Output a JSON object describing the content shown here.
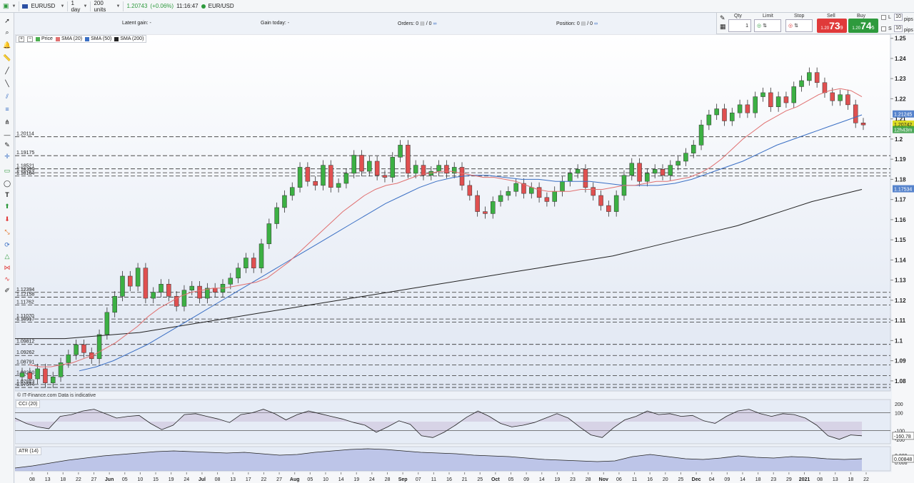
{
  "toolbar": {
    "symbol": "EURUSD",
    "timeframe": "1 day",
    "units": "200 units",
    "price": "1.20743",
    "change": "(+0.06%)",
    "time": "11:16:47",
    "instrument": "EUR/USD"
  },
  "info_bar": {
    "latent_gain": "Latent gain: -",
    "gain_today": "Gain today: -",
    "orders_label": "Orders:",
    "orders_value": "0",
    "orders_value2": "0",
    "position_label": "Position:",
    "position_value": "0",
    "position_value2": "0"
  },
  "trade_panel": {
    "qty_label": "Qty",
    "qty_value": "1",
    "limit_label": "Limit",
    "stop_label": "Stop",
    "sell_label": "Sell",
    "buy_label": "Buy",
    "sell_prefix": "1.20",
    "sell_big": "73",
    "sell_sup": "9",
    "buy_prefix": "1.20",
    "buy_big": "74",
    "buy_sup": "5",
    "l_label": "L",
    "s_label": "S",
    "l_value": "10",
    "s_value": "10",
    "pips_label": "pips",
    "sell_color": "#e03a3a",
    "buy_color": "#2e9a3d"
  },
  "legend": {
    "items": [
      {
        "label": "Price",
        "color": "#4caf50"
      },
      {
        "label": "SMA (20)",
        "color": "#e07070"
      },
      {
        "label": "SMA (50)",
        "color": "#3a6fc4"
      },
      {
        "label": "SMA (200)",
        "color": "#222222"
      }
    ]
  },
  "watermark": "© IT-Finance.com  Data is indicative",
  "cci_label": "CCI (20)",
  "atr_label": "ATR (14)",
  "chart_data": {
    "type": "candlestick",
    "instrument": "EURUSD",
    "y_ticks": [
      "1.25",
      "1.24",
      "1.23",
      "1.22",
      "1.21",
      "1.2",
      "1.19",
      "1.18",
      "1.17",
      "1.16",
      "1.15",
      "1.14",
      "1.13",
      "1.12",
      "1.11",
      "1.1",
      "1.09",
      "1.08"
    ],
    "ylim": [
      1.075,
      1.252
    ],
    "x_labels": [
      "08",
      "13",
      "18",
      "22",
      "27",
      "Jun",
      "05",
      "10",
      "15",
      "19",
      "24",
      "Jul",
      "08",
      "13",
      "17",
      "22",
      "27",
      "Aug",
      "05",
      "10",
      "14",
      "19",
      "24",
      "28",
      "Sep",
      "07",
      "11",
      "16",
      "21",
      "25",
      "Oct",
      "05",
      "09",
      "14",
      "19",
      "23",
      "28",
      "Nov",
      "06",
      "11",
      "16",
      "20",
      "25",
      "Dec",
      "04",
      "09",
      "14",
      "18",
      "23",
      "29",
      "2021",
      "08",
      "13",
      "18",
      "22"
    ],
    "right_markers": [
      {
        "label": "1.21245",
        "value": 1.21245,
        "color": "#3a6fc4"
      },
      {
        "label": "1.20742",
        "value": 1.20742,
        "color": "#d8d800"
      },
      {
        "label": "12h43m",
        "value": 1.2047,
        "color": "#2e9a3d"
      },
      {
        "label": "1.17534",
        "value": 1.17534,
        "color": "#3a6fc4"
      }
    ],
    "horizontal_levels": [
      {
        "label": "1.20114",
        "value": 1.20114
      },
      {
        "label": "1.19175",
        "value": 1.19175
      },
      {
        "label": "1.18521",
        "value": 1.18521
      },
      {
        "label": "1.18329",
        "value": 1.18329
      },
      {
        "label": "1.18164",
        "value": 1.18164
      },
      {
        "label": "1.12394",
        "value": 1.12394
      },
      {
        "label": "1.12158",
        "value": 1.12158
      },
      {
        "label": "1.11762",
        "value": 1.11762
      },
      {
        "label": "1.11070",
        "value": 1.1107
      },
      {
        "label": "1.10917",
        "value": 1.10917
      },
      {
        "label": "1.09812",
        "value": 1.09812
      },
      {
        "label": "1.09262",
        "value": 1.09262
      },
      {
        "label": "1.08791",
        "value": 1.08791
      },
      {
        "label": "1.08260",
        "value": 1.0826
      },
      {
        "label": "1.07823",
        "value": 1.07823
      },
      {
        "label": "1.07674",
        "value": 1.07674
      }
    ],
    "close_series": [
      1.084,
      1.081,
      1.086,
      1.079,
      1.082,
      1.089,
      1.093,
      1.098,
      1.094,
      1.091,
      1.103,
      1.114,
      1.122,
      1.132,
      1.127,
      1.136,
      1.121,
      1.124,
      1.128,
      1.122,
      1.117,
      1.125,
      1.127,
      1.121,
      1.126,
      1.124,
      1.128,
      1.131,
      1.136,
      1.141,
      1.136,
      1.148,
      1.158,
      1.166,
      1.172,
      1.176,
      1.186,
      1.179,
      1.177,
      1.187,
      1.176,
      1.178,
      1.183,
      1.192,
      1.184,
      1.189,
      1.182,
      1.181,
      1.191,
      1.197,
      1.183,
      1.187,
      1.182,
      1.184,
      1.187,
      1.183,
      1.186,
      1.177,
      1.172,
      1.164,
      1.163,
      1.169,
      1.172,
      1.174,
      1.178,
      1.173,
      1.176,
      1.171,
      1.169,
      1.174,
      1.179,
      1.183,
      1.185,
      1.176,
      1.172,
      1.167,
      1.164,
      1.172,
      1.182,
      1.188,
      1.179,
      1.183,
      1.185,
      1.182,
      1.187,
      1.189,
      1.193,
      1.197,
      1.207,
      1.212,
      1.215,
      1.209,
      1.213,
      1.217,
      1.213,
      1.221,
      1.223,
      1.216,
      1.221,
      1.218,
      1.226,
      1.229,
      1.233,
      1.228,
      1.223,
      1.219,
      1.222,
      1.217,
      1.208,
      1.207
    ],
    "sma20": [
      1.088,
      1.087,
      1.087,
      1.088,
      1.089,
      1.091,
      1.093,
      1.096,
      1.099,
      1.103,
      1.107,
      1.112,
      1.116,
      1.119,
      1.122,
      1.124,
      1.125,
      1.126,
      1.126,
      1.127,
      1.128,
      1.129,
      1.131,
      1.135,
      1.139,
      1.144,
      1.149,
      1.154,
      1.159,
      1.164,
      1.168,
      1.172,
      1.175,
      1.177,
      1.178,
      1.18,
      1.182,
      1.183,
      1.184,
      1.184,
      1.183,
      1.182,
      1.181,
      1.181,
      1.18,
      1.179,
      1.177,
      1.175,
      1.174,
      1.174,
      1.174,
      1.175,
      1.175,
      1.175,
      1.176,
      1.177,
      1.177,
      1.178,
      1.179,
      1.179,
      1.18,
      1.181,
      1.183,
      1.186,
      1.19,
      1.195,
      1.2,
      1.204,
      1.208,
      1.211,
      1.214,
      1.216,
      1.219,
      1.222,
      1.224,
      1.225,
      1.224,
      1.221
    ],
    "sma50": [
      1.085,
      1.087,
      1.09,
      1.094,
      1.098,
      1.103,
      1.108,
      1.113,
      1.118,
      1.123,
      1.128,
      1.133,
      1.138,
      1.143,
      1.148,
      1.153,
      1.158,
      1.163,
      1.168,
      1.172,
      1.176,
      1.179,
      1.181,
      1.182,
      1.182,
      1.181,
      1.18,
      1.18,
      1.179,
      1.179,
      1.179,
      1.178,
      1.177,
      1.177,
      1.177,
      1.178,
      1.18,
      1.183,
      1.186,
      1.189,
      1.193,
      1.197,
      1.2,
      1.203,
      1.206,
      1.209,
      1.212
    ],
    "sma200": [
      1.101,
      1.101,
      1.101,
      1.102,
      1.103,
      1.104,
      1.106,
      1.108,
      1.11,
      1.112,
      1.114,
      1.116,
      1.118,
      1.12,
      1.122,
      1.124,
      1.126,
      1.128,
      1.13,
      1.132,
      1.134,
      1.136,
      1.138,
      1.14,
      1.142,
      1.145,
      1.148,
      1.151,
      1.154,
      1.157,
      1.161,
      1.165,
      1.169,
      1.172,
      1.175
    ],
    "cci_ticks": [
      "200",
      "100",
      "-100",
      "-200"
    ],
    "cci_value_label": "-160.78",
    "cci": [
      40,
      -20,
      -60,
      -80,
      60,
      80,
      120,
      140,
      90,
      40,
      60,
      70,
      -20,
      -90,
      -40,
      80,
      90,
      60,
      30,
      -10,
      80,
      100,
      140,
      90,
      20,
      80,
      120,
      90,
      60,
      30,
      -10,
      -40,
      -120,
      -60,
      10,
      -30,
      -160,
      -180,
      -120,
      -40,
      50,
      120,
      60,
      -20,
      -60,
      -40,
      -10,
      40,
      90,
      40,
      -60,
      -150,
      -180,
      -70,
      20,
      60,
      120,
      80,
      90,
      60,
      70,
      10,
      -20,
      60,
      120,
      140,
      90,
      60,
      90,
      80,
      40,
      -40,
      -160,
      -200,
      -150,
      -160
    ],
    "atr_ticks": [
      "0.009",
      "0.008"
    ],
    "atr_value_label": "0.00848",
    "atr": [
      0.0072,
      0.0075,
      0.0079,
      0.0083,
      0.0086,
      0.0089,
      0.0091,
      0.0093,
      0.0095,
      0.0096,
      0.0095,
      0.0094,
      0.0093,
      0.0094,
      0.0092,
      0.009,
      0.0091,
      0.0094,
      0.0096,
      0.0098,
      0.0099,
      0.0098,
      0.0096,
      0.0094,
      0.0093,
      0.0092,
      0.009,
      0.0089,
      0.0088,
      0.0086,
      0.0084,
      0.0083,
      0.0082,
      0.0081,
      0.0082,
      0.0088,
      0.0091,
      0.0088,
      0.0085,
      0.0084,
      0.0086,
      0.0089,
      0.0087,
      0.0086,
      0.0088,
      0.0087,
      0.0085,
      0.0084,
      0.0085
    ]
  }
}
